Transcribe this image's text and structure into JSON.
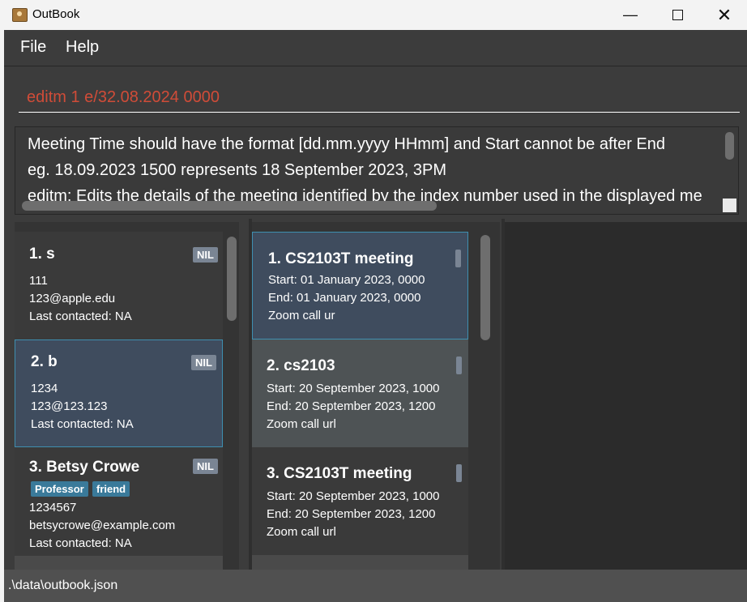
{
  "window": {
    "title": "OutBook",
    "minimize_icon": "minimize-icon",
    "maximize_icon": "maximize-icon",
    "close_icon": "close-icon"
  },
  "menu": {
    "items": [
      "File",
      "Help"
    ]
  },
  "command": {
    "value": "editm 1 e/32.08.2024 0000"
  },
  "result": {
    "lines": [
      "Meeting Time should have the format [dd.mm.yyyy HHmm] and Start cannot be after End",
      "eg. 18.09.2023 1500 represents 18 September 2023, 3PM",
      "editm: Edits the details of the meeting identified by the index number used in the displayed me"
    ]
  },
  "persons": [
    {
      "title": "1.  s",
      "badge": "NIL",
      "tags": [],
      "phone": "111",
      "email": "123@apple.edu",
      "last": "Last contacted: NA"
    },
    {
      "title": "2.  b",
      "badge": "NIL",
      "tags": [],
      "phone": "1234",
      "email": "123@123.123",
      "last": "Last contacted: NA"
    },
    {
      "title": "3.  Betsy Crowe",
      "badge": "NIL",
      "tags": [
        "Professor",
        "friend"
      ],
      "phone": "1234567",
      "email": "betsycrowe@example.com",
      "last": "Last contacted: NA"
    }
  ],
  "meetings": [
    {
      "title": "1.  CS2103T meeting",
      "start": "Start: 01 January 2023, 0000",
      "end": "End: 01 January 2023, 0000",
      "location": "Zoom call ur"
    },
    {
      "title": "2.  cs2103",
      "start": "Start: 20 September 2023, 1000",
      "end": "End: 20 September 2023, 1200",
      "location": "Zoom call url"
    },
    {
      "title": "3.  CS2103T meeting",
      "start": "Start: 20 September 2023, 1000",
      "end": "End: 20 September 2023, 1200",
      "location": "Zoom call url"
    }
  ],
  "status": {
    "path": ".\\data\\outbook.json"
  },
  "colors": {
    "accent": "#3e8fb0",
    "error_text": "#d04c38",
    "selected_card": "#3f4c5e"
  }
}
